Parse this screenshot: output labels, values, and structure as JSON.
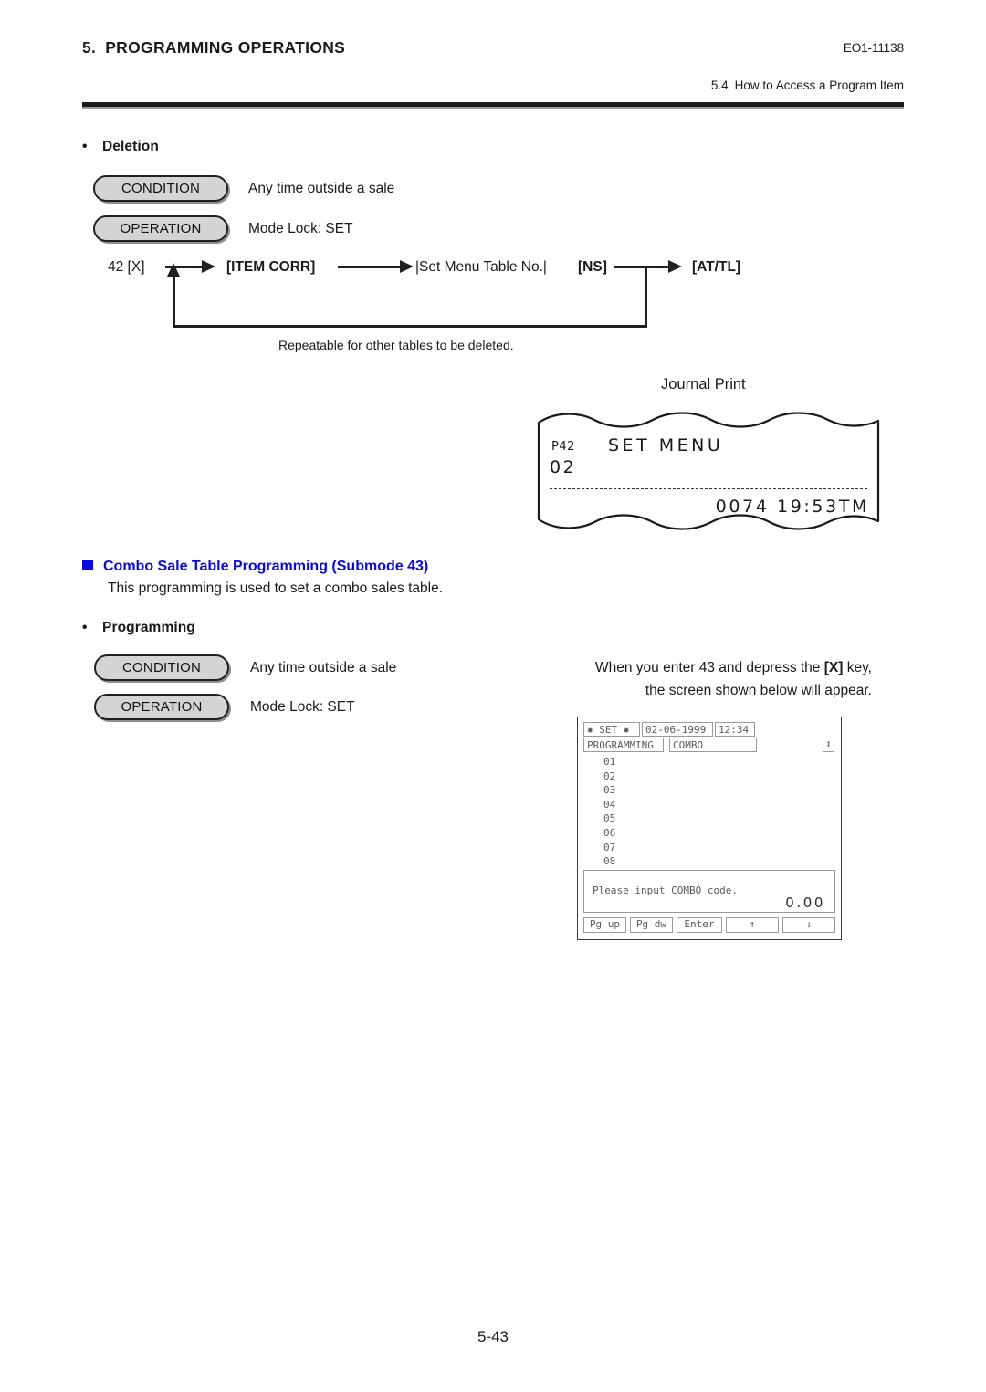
{
  "header": {
    "chapter_number": "5.",
    "chapter_title": "PROGRAMMING OPERATIONS",
    "doc_code": "EO1-11138",
    "section_number": "5.4",
    "section_title": "How to Access a Program Item"
  },
  "deletion": {
    "bullet": "•",
    "heading": "Deletion",
    "condition_label": "CONDITION",
    "condition_text": "Any time outside a sale",
    "operation_label": "OPERATION",
    "operation_text": "Mode Lock:  SET",
    "flow": {
      "start": "42 [X]",
      "item_corr": "[ITEM CORR]",
      "field": "|Set Menu Table No.|",
      "ns": "[NS]",
      "at_tl": "[AT/TL]",
      "loop_caption": "Repeatable for other tables to be deleted."
    }
  },
  "journal": {
    "label": "Journal Print",
    "code": "P42",
    "title": "SET MENU",
    "table_no": "02",
    "footer": "0074 19:53TM"
  },
  "combo": {
    "heading": "Combo Sale Table Programming (Submode 43)",
    "description": "This programming is used to set a combo sales table.",
    "bullet": "•",
    "sub_heading": "Programming",
    "condition_label": "CONDITION",
    "condition_text": "Any time outside a sale",
    "operation_label": "OPERATION",
    "operation_text": "Mode Lock:  SET",
    "note_line1_a": "When you enter 43 and depress the ",
    "note_line1_key": "[X]",
    "note_line1_b": " key,",
    "note_line2": "the screen shown below will appear."
  },
  "lcd": {
    "mode": "✹ SET ✹",
    "date": "02-06-1999",
    "time": "12:34",
    "mode_label": "PROGRAMMING",
    "menu_label": "COMBO",
    "scroll_icon": "↧",
    "rows": [
      "01",
      "02",
      "03",
      "04",
      "05",
      "06",
      "07",
      "08"
    ],
    "message": "Please input COMBO code.",
    "amount": "0.00",
    "buttons": [
      "Pg up",
      "Pg dw",
      "Enter",
      "↑",
      "↓"
    ]
  },
  "footer": {
    "page_number": "5-43"
  },
  "colors": {
    "heading_blue": "#0a0ae0",
    "ink": "#1a1a1a",
    "pill_fill": "#d4d4d4",
    "lcd_text": "#5a5a5a"
  }
}
